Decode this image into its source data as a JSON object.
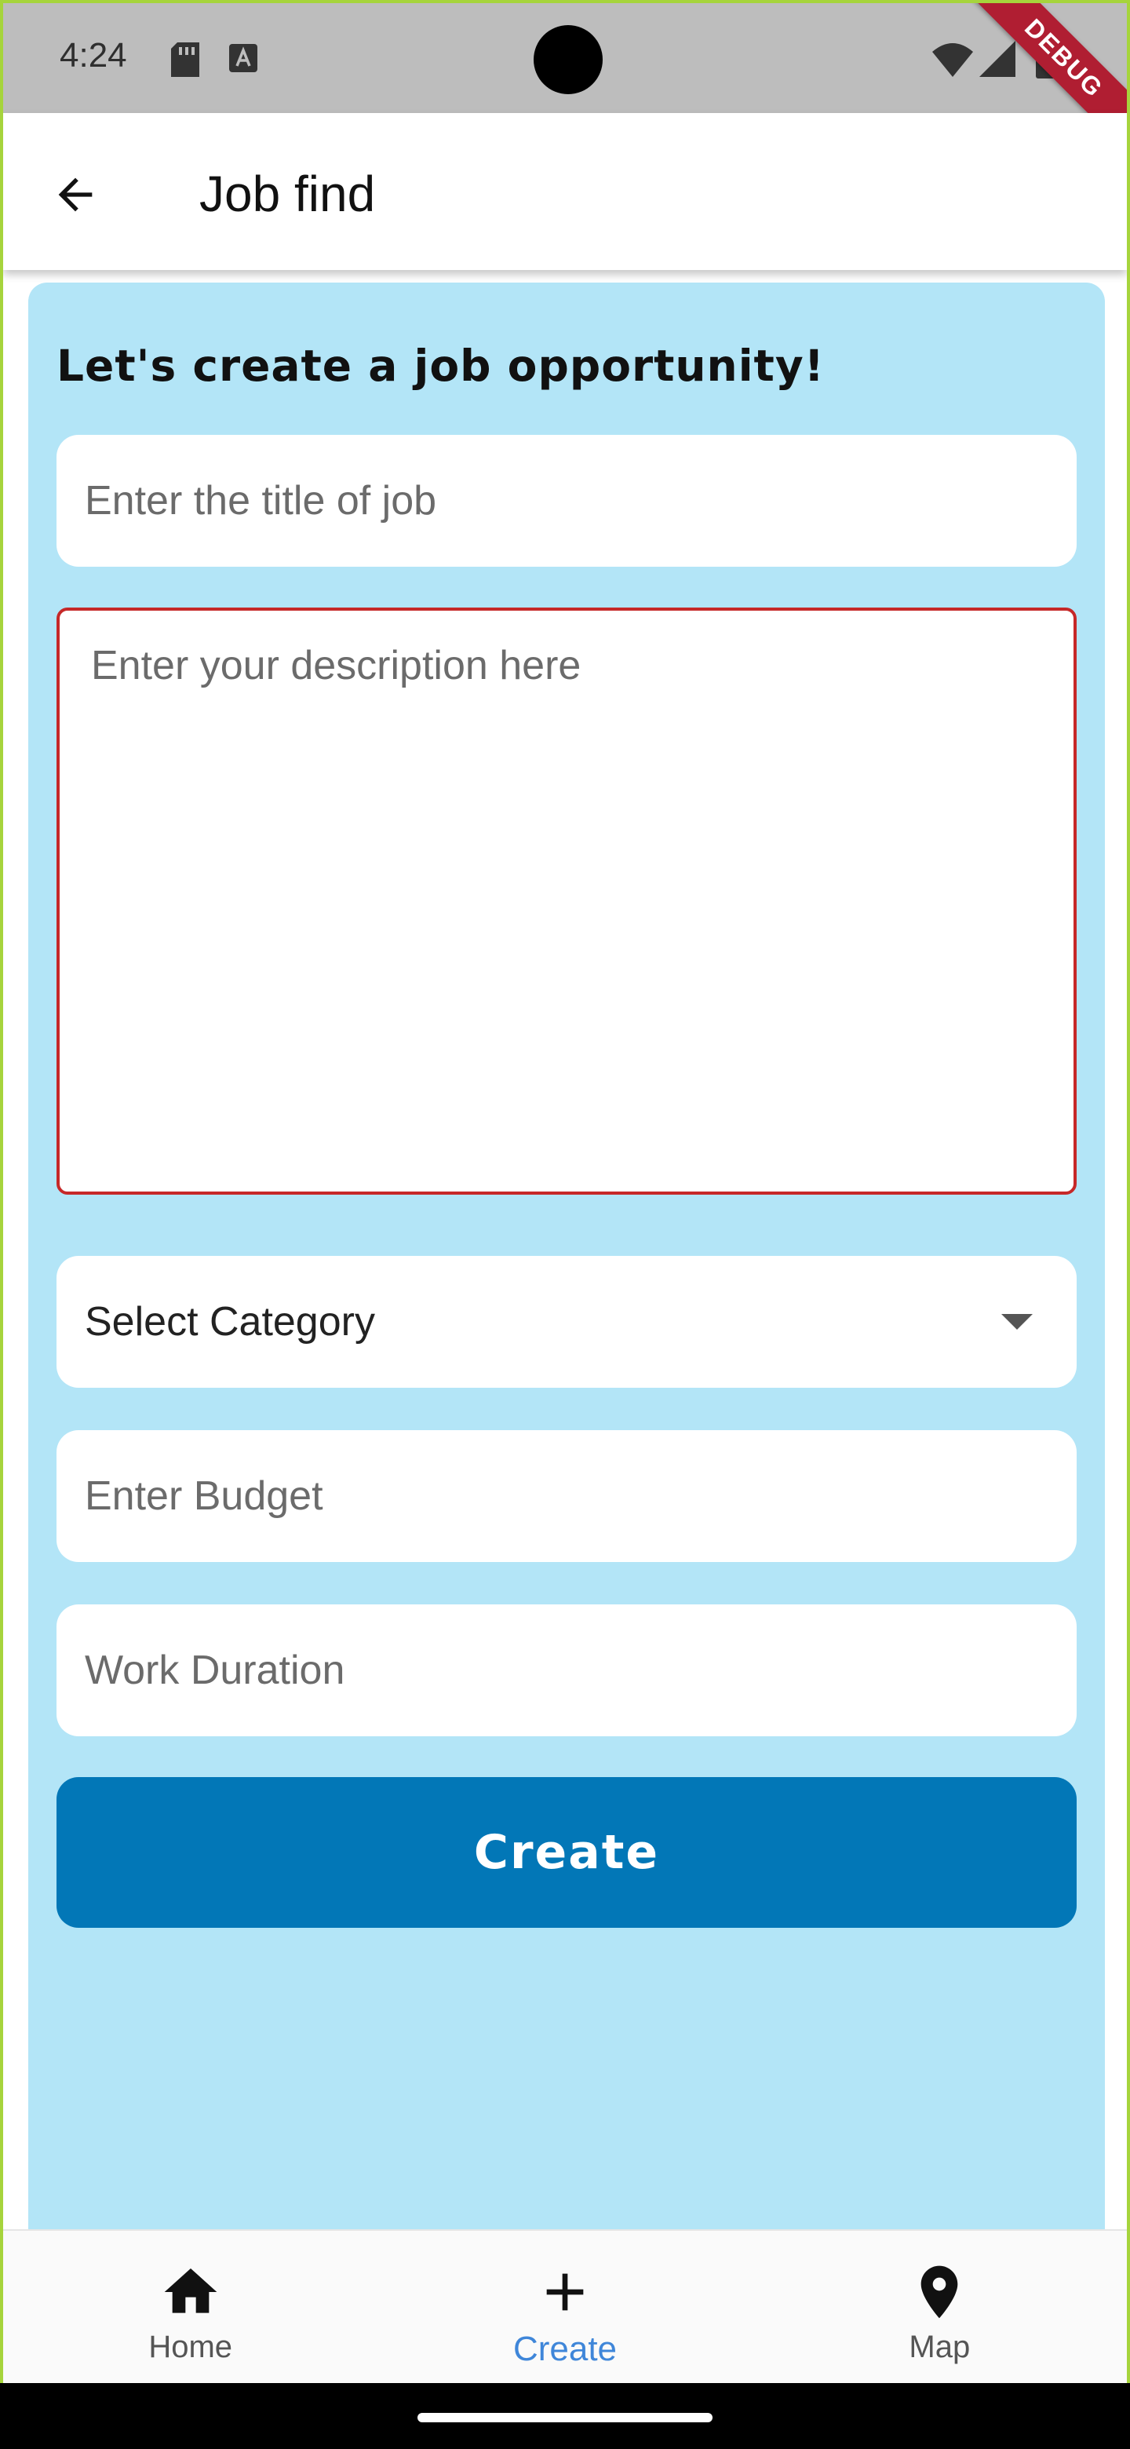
{
  "status_bar": {
    "time": "4:24",
    "debug_label": "DEBUG"
  },
  "app_bar": {
    "title": "Job find",
    "back_icon": "arrow-back-icon"
  },
  "form": {
    "heading": "Let's create a job opportunity!",
    "title_placeholder": "Enter the title of job",
    "description_placeholder": "Enter your description here",
    "category_label": "Select Category",
    "budget_placeholder": "Enter Budget",
    "duration_placeholder": "Work Duration",
    "create_label": "Create"
  },
  "bottom_nav": {
    "items": [
      {
        "label": "Home",
        "icon": "home-icon",
        "active": false
      },
      {
        "label": "Create",
        "icon": "plus-icon",
        "active": true
      },
      {
        "label": "Map",
        "icon": "map-pin-icon",
        "active": false
      }
    ]
  },
  "colors": {
    "card_background": "#b3e5f7",
    "button": "#0277b7",
    "active_nav": "#3f86d9",
    "error_border": "#c62828",
    "debug_banner": "#b01e32"
  }
}
